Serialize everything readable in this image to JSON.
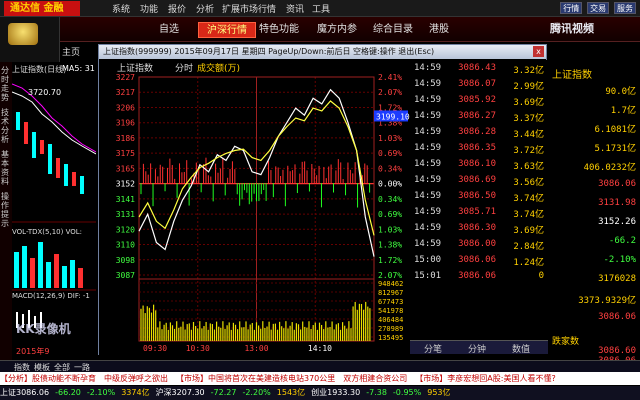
{
  "app": {
    "logo": "通达信 金融",
    "home": "主页"
  },
  "menu": [
    "系统",
    "功能",
    "报价",
    "分析",
    "扩展市场行情",
    "资讯",
    "工具"
  ],
  "title_buttons": [
    "行情",
    "交易",
    "服务"
  ],
  "tabs": [
    "自选",
    "沪深行情",
    "特色功能",
    "魔方内参",
    "综合目录",
    "港股"
  ],
  "video_logo": "腾讯视频",
  "left_panel": {
    "header": "上证指数(日线)",
    "ma": "MA5: 31",
    "price_label": "3720.70",
    "vol_label": "VOL-TDX(5,10) VOL:",
    "macd_label": "MACD(12,26,9)  DIF: -1",
    "date": "2015年9",
    "watermark": "KK录像机",
    "side_labels": [
      "分时走势",
      "技术分析",
      "基本资料",
      "操作提示"
    ]
  },
  "window": {
    "title": "上证指数(999999) 2015年09月17日 星期四 PageUp/Down:前后日 空格键:操作 退出(Esc)",
    "close": "x",
    "chart_head": {
      "name": "上证指数",
      "mode": "分时",
      "field": "成交额(万)"
    }
  },
  "chart_data": {
    "type": "line",
    "prev_close": 3152,
    "price_ticks": [
      3227,
      3217,
      3206,
      3196,
      3186,
      3175,
      3165,
      3152,
      3141,
      3131,
      3120,
      3110,
      3098,
      3087
    ],
    "pct_ticks": [
      "2.41%",
      "2.07%",
      "1.72%",
      "1.38%",
      "1.03%",
      "0.69%",
      "0.34%",
      "0.00%",
      "0.34%",
      "0.69%",
      "1.03%",
      "1.38%",
      "1.72%",
      "2.07%"
    ],
    "volume_ticks": [
      948462,
      812967,
      677473,
      541978,
      406484,
      270989,
      135495
    ],
    "time_labels": [
      "09:30",
      "10:30",
      "13:00",
      "14:10"
    ],
    "cursor_value": "3199.10",
    "series": [
      {
        "name": "",
        "values": [
          3118,
          3130,
          3110,
          3105,
          3125,
          3140,
          3150,
          3165,
          3160,
          3172,
          3168,
          3178,
          3175,
          3160,
          3158,
          3170,
          3185,
          3195,
          3205,
          3200,
          3212,
          3208,
          3218,
          3212,
          3195,
          3175,
          3128,
          3100
        ]
      },
      {
        "name": "",
        "values": [
          3128,
          3138,
          3125,
          3120,
          3133,
          3148,
          3156,
          3163,
          3166,
          3170,
          3173,
          3175,
          3176,
          3170,
          3168,
          3175,
          3185,
          3192,
          3198,
          3196,
          3205,
          3203,
          3210,
          3205,
          3192,
          3175,
          3140,
          3115
        ]
      }
    ]
  },
  "ticks": [
    {
      "t": "14:59",
      "p": "3086.43",
      "v": "3.32亿"
    },
    {
      "t": "14:59",
      "p": "3086.07",
      "v": "2.99亿"
    },
    {
      "t": "14:59",
      "p": "3085.92",
      "v": "3.69亿"
    },
    {
      "t": "14:59",
      "p": "3086.27",
      "v": "3.37亿"
    },
    {
      "t": "14:59",
      "p": "3086.28",
      "v": "3.44亿"
    },
    {
      "t": "14:59",
      "p": "3086.35",
      "v": "3.72亿"
    },
    {
      "t": "14:59",
      "p": "3086.10",
      "v": "3.63亿"
    },
    {
      "t": "14:59",
      "p": "3086.69",
      "v": "3.56亿"
    },
    {
      "t": "14:59",
      "p": "3086.50",
      "v": "3.74亿"
    },
    {
      "t": "14:59",
      "p": "3085.71",
      "v": "3.74亿"
    },
    {
      "t": "14:59",
      "p": "3086.30",
      "v": "3.69亿"
    },
    {
      "t": "14:59",
      "p": "3086.00",
      "v": "2.84亿"
    },
    {
      "t": "15:00",
      "p": "3086.06",
      "v": "1.24亿"
    },
    {
      "t": "15:01",
      "p": "3086.06",
      "v": "0"
    }
  ],
  "tick_tabs": [
    "分笔",
    "分钟",
    "数值"
  ],
  "right_panel": {
    "title": "上证指数",
    "rows": [
      {
        "l": "",
        "v": "90.0亿",
        "c": "#ffd000"
      },
      {
        "l": "",
        "v": "1.7亿",
        "c": "#ffd000"
      },
      {
        "l": "",
        "v": "6.1081亿",
        "c": "#ffd000"
      },
      {
        "l": "",
        "v": "5.1731亿",
        "c": "#ffd000"
      },
      {
        "l": "",
        "v": "406.0232亿",
        "c": "#ffd000"
      },
      {
        "l": "",
        "v": "3086.06",
        "c": "#ff4040"
      },
      {
        "l": "",
        "v": "3131.98",
        "c": "#ff4040"
      },
      {
        "l": "",
        "v": "3152.26",
        "c": "#ffffff"
      },
      {
        "l": "",
        "v": "-66.2",
        "c": "#40ff40"
      },
      {
        "l": "",
        "v": "-2.10%",
        "c": "#40ff40"
      },
      {
        "l": "",
        "v": "3176028",
        "c": "#ffd000"
      },
      {
        "l": "",
        "v": "3373.9329亿",
        "c": "#ffd000"
      },
      {
        "l": "",
        "v": "3086.06",
        "c": "#ff4040"
      }
    ],
    "bottom_label": "跌家数",
    "bottom_vals": [
      "3086.60",
      "3086.06"
    ]
  },
  "bottom_tabs": [
    "指数",
    "模板",
    "全部",
    "一路"
  ],
  "bottom_tabs2": [
    "沪深",
    "互联",
    "关联报价"
  ],
  "news": [
    "【分析】股债动能不断孕育",
    "中级反弹呼之欲出",
    "【市场】中国将首次在美建造核电站370公里",
    "双方相建合资公司",
    "【市场】李彦宏想回A股:美国人看不懂?"
  ],
  "status": [
    {
      "t": "上证3086.06",
      "c": "#ffffff"
    },
    {
      "t": "-66.20",
      "c": "#40ff40"
    },
    {
      "t": "-2.10%",
      "c": "#40ff40"
    },
    {
      "t": "3374亿",
      "c": "#ffd000"
    },
    {
      "t": "沪深3207.30",
      "c": "#ffffff"
    },
    {
      "t": "-72.27",
      "c": "#40ff40"
    },
    {
      "t": "-2.20%",
      "c": "#40ff40"
    },
    {
      "t": "1543亿",
      "c": "#ffd000"
    },
    {
      "t": "创业1933.30",
      "c": "#ffffff"
    },
    {
      "t": "-7.38",
      "c": "#40ff40"
    },
    {
      "t": "-0.95%",
      "c": "#40ff40"
    },
    {
      "t": "953亿",
      "c": "#ffd000"
    }
  ]
}
